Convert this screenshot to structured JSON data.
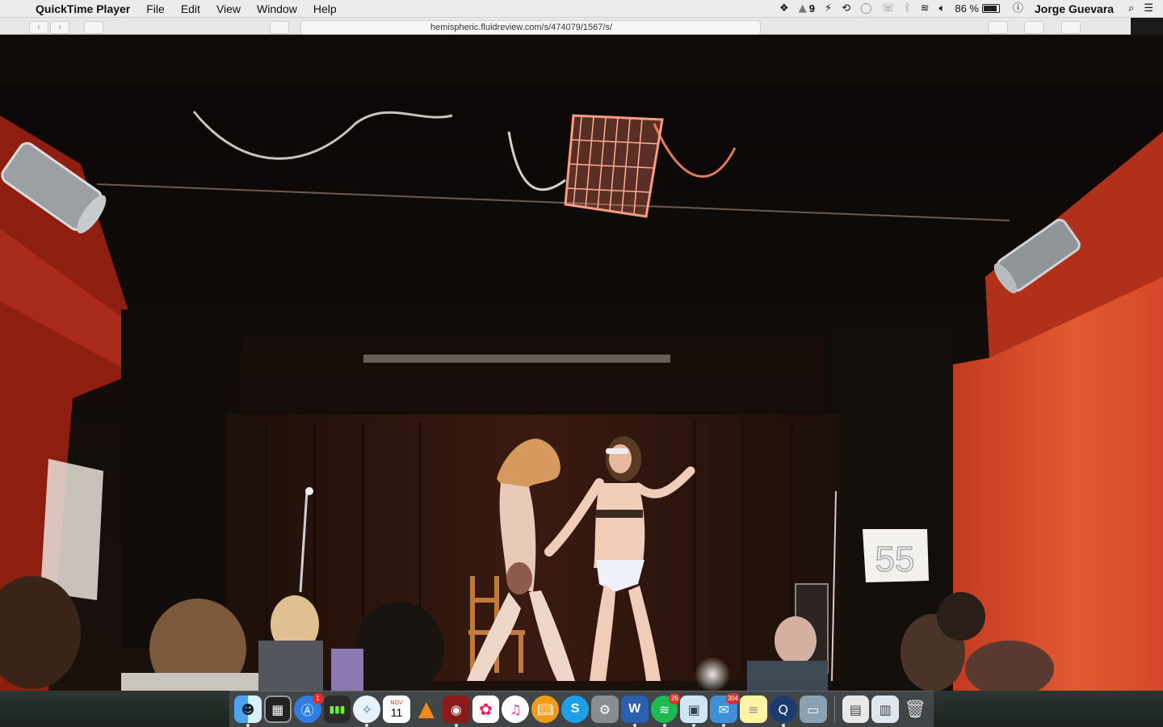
{
  "menubar": {
    "app_name": "QuickTime Player",
    "items": [
      "File",
      "Edit",
      "View",
      "Window",
      "Help"
    ],
    "status": {
      "adobe_count": "9",
      "battery": "86 %",
      "user": "Jorge Guevara"
    }
  },
  "browser": {
    "url": "hemispheric.fluidreview.com/s/474079/1567/s/"
  },
  "stage": {
    "sign_number": "55"
  },
  "dock": {
    "calendar_month": "NOV",
    "calendar_day": "11",
    "appstore_badge": "1",
    "spotify_badge": "26",
    "mail_badge": "304"
  },
  "colors": {
    "stage_red": "#b8321c",
    "wall_orange": "#d24a2a",
    "menubar_bg": "#ececec"
  }
}
